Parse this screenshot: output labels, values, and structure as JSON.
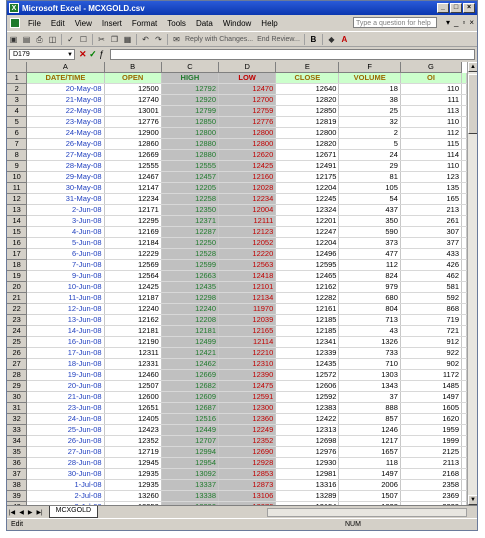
{
  "window": {
    "title": "Microsoft Excel - MCXGOLD.csv"
  },
  "menu": [
    "File",
    "Edit",
    "View",
    "Insert",
    "Format",
    "Tools",
    "Data",
    "Window",
    "Help"
  ],
  "ask_placeholder": "Type a question for help",
  "toolbar": {
    "reply_text": "Reply with Changes...",
    "end_review": "End Review..."
  },
  "namebox": "D179",
  "columns": [
    "A",
    "B",
    "C",
    "D",
    "E",
    "F",
    "G"
  ],
  "header_row": [
    "DATE/TIME",
    "OPEN",
    "HIGH",
    "LOW",
    "CLOSE",
    "VOLUME",
    "OI"
  ],
  "rows": [
    [
      "20-May-08",
      "12500",
      "12792",
      "12470",
      "12640",
      "18",
      "110"
    ],
    [
      "21-May-08",
      "12740",
      "12920",
      "12700",
      "12820",
      "38",
      "111"
    ],
    [
      "22-May-08",
      "13001",
      "12799",
      "12759",
      "12850",
      "25",
      "113"
    ],
    [
      "23-May-08",
      "12776",
      "12850",
      "12776",
      "12819",
      "32",
      "110"
    ],
    [
      "24-May-08",
      "12900",
      "12800",
      "12800",
      "12800",
      "2",
      "112"
    ],
    [
      "26-May-08",
      "12860",
      "12880",
      "12800",
      "12820",
      "5",
      "115"
    ],
    [
      "27-May-08",
      "12669",
      "12880",
      "12620",
      "12671",
      "24",
      "114"
    ],
    [
      "28-May-08",
      "12555",
      "12555",
      "12425",
      "12491",
      "29",
      "110"
    ],
    [
      "29-May-08",
      "12467",
      "12457",
      "12160",
      "12175",
      "81",
      "123"
    ],
    [
      "30-May-08",
      "12147",
      "12205",
      "12028",
      "12204",
      "105",
      "135"
    ],
    [
      "31-May-08",
      "12234",
      "12258",
      "12234",
      "12245",
      "54",
      "165"
    ],
    [
      "2-Jun-08",
      "12171",
      "12350",
      "12004",
      "12324",
      "437",
      "213"
    ],
    [
      "3-Jun-08",
      "12295",
      "12371",
      "12111",
      "12201",
      "350",
      "261"
    ],
    [
      "4-Jun-08",
      "12169",
      "12287",
      "12123",
      "12247",
      "590",
      "307"
    ],
    [
      "5-Jun-08",
      "12184",
      "12250",
      "12052",
      "12204",
      "373",
      "377"
    ],
    [
      "6-Jun-08",
      "12229",
      "12528",
      "12220",
      "12496",
      "477",
      "433"
    ],
    [
      "7-Jun-08",
      "12569",
      "12599",
      "12563",
      "12595",
      "112",
      "426"
    ],
    [
      "9-Jun-08",
      "12564",
      "12663",
      "12418",
      "12465",
      "824",
      "462"
    ],
    [
      "10-Jun-08",
      "12425",
      "12435",
      "12101",
      "12162",
      "979",
      "581"
    ],
    [
      "11-Jun-08",
      "12187",
      "12298",
      "12134",
      "12282",
      "680",
      "592"
    ],
    [
      "12-Jun-08",
      "12240",
      "12240",
      "11970",
      "12161",
      "804",
      "868"
    ],
    [
      "13-Jun-08",
      "12162",
      "12208",
      "12039",
      "12185",
      "713",
      "719"
    ],
    [
      "14-Jun-08",
      "12181",
      "12181",
      "12165",
      "12185",
      "43",
      "721"
    ],
    [
      "16-Jun-08",
      "12190",
      "12499",
      "12114",
      "12341",
      "1326",
      "912"
    ],
    [
      "17-Jun-08",
      "12311",
      "12421",
      "12210",
      "12339",
      "733",
      "922"
    ],
    [
      "18-Jun-08",
      "12331",
      "12462",
      "12310",
      "12435",
      "710",
      "902"
    ],
    [
      "19-Jun-08",
      "12460",
      "12669",
      "12390",
      "12572",
      "1303",
      "1172"
    ],
    [
      "20-Jun-08",
      "12507",
      "12682",
      "12475",
      "12606",
      "1343",
      "1485"
    ],
    [
      "21-Jun-08",
      "12600",
      "12609",
      "12591",
      "12592",
      "37",
      "1497"
    ],
    [
      "23-Jun-08",
      "12651",
      "12687",
      "12300",
      "12383",
      "888",
      "1605"
    ],
    [
      "24-Jun-08",
      "12405",
      "12516",
      "12360",
      "12422",
      "857",
      "1620"
    ],
    [
      "25-Jun-08",
      "12423",
      "12449",
      "12249",
      "12313",
      "1246",
      "1959"
    ],
    [
      "26-Jun-08",
      "12352",
      "12707",
      "12352",
      "12698",
      "1217",
      "1999"
    ],
    [
      "27-Jun-08",
      "12719",
      "12994",
      "12690",
      "12976",
      "1657",
      "2125"
    ],
    [
      "28-Jun-08",
      "12945",
      "12954",
      "12928",
      "12930",
      "118",
      "2113"
    ],
    [
      "30-Jun-08",
      "12935",
      "13092",
      "12853",
      "12981",
      "1497",
      "2168"
    ],
    [
      "1-Jul-08",
      "12935",
      "13337",
      "12873",
      "13316",
      "2006",
      "2358"
    ],
    [
      "2-Jul-08",
      "13260",
      "13338",
      "13106",
      "13289",
      "1507",
      "2369"
    ],
    [
      "3-Jul-08",
      "13250",
      "13290",
      "13076",
      "13154",
      "1822",
      "2329"
    ]
  ],
  "sheet_tab": "MCXGOLD",
  "status": {
    "mode": "Edit",
    "num": "NUM"
  }
}
